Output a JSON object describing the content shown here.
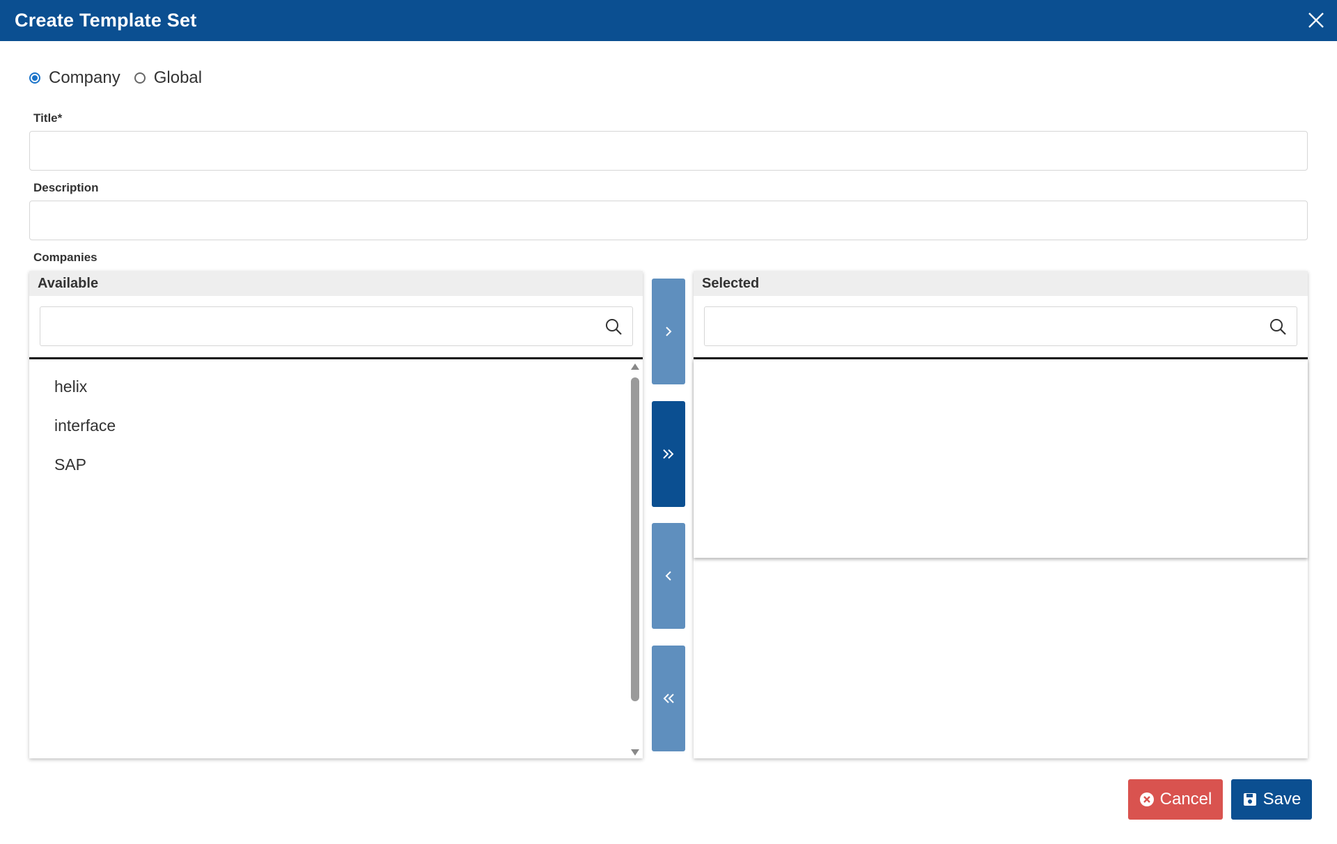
{
  "dialog": {
    "title": "Create Template Set"
  },
  "scope": {
    "options": [
      {
        "label": "Company",
        "checked": true
      },
      {
        "label": "Global",
        "checked": false
      }
    ]
  },
  "form": {
    "title_label": "Title*",
    "title_value": "",
    "description_label": "Description",
    "description_value": "",
    "companies_label": "Companies"
  },
  "available": {
    "header": "Available",
    "search_value": "",
    "items": [
      "helix",
      "interface",
      "SAP"
    ]
  },
  "selected": {
    "header": "Selected",
    "search_value": "",
    "items": []
  },
  "transfer_buttons": [
    {
      "symbol": "›",
      "name": "move-right",
      "active": false
    },
    {
      "symbol": "»",
      "name": "move-all-right",
      "active": true
    },
    {
      "symbol": "‹",
      "name": "move-left",
      "active": false
    },
    {
      "symbol": "«",
      "name": "move-all-left",
      "active": false
    }
  ],
  "footer": {
    "cancel_label": "Cancel",
    "save_label": "Save"
  },
  "colors": {
    "titlebar": "#0b4f91",
    "primary": "#0b4f91",
    "transfer_inactive": "#5f8fbe",
    "cancel": "#d9534f"
  }
}
